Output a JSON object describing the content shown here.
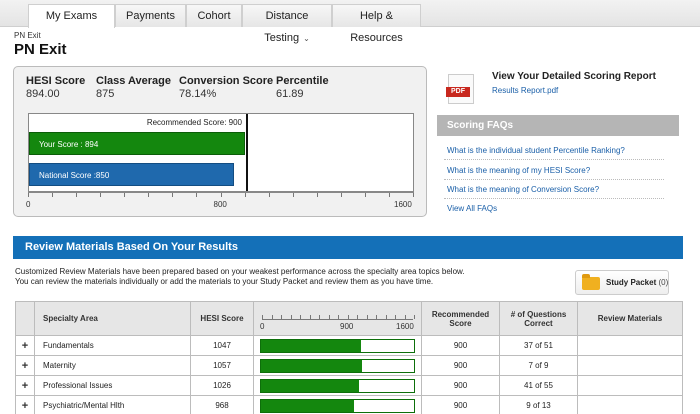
{
  "tabs": [
    {
      "label": "My Exams",
      "active": true
    },
    {
      "label": "Payments"
    },
    {
      "label": "Cohort"
    },
    {
      "label": "Distance Testing",
      "dropdown": true
    },
    {
      "label": "Help & Resources"
    }
  ],
  "breadcrumb": "PN Exit",
  "page_title": "PN Exit",
  "stats": {
    "hesi": {
      "label": "HESI Score",
      "value": "894.00"
    },
    "class_avg": {
      "label": "Class Average",
      "value": "875"
    },
    "conversion": {
      "label": "Conversion Score",
      "value": "78.14%"
    },
    "percentile": {
      "label": "Percentile",
      "value": "61.89"
    }
  },
  "chart_data": {
    "type": "bar",
    "orientation": "horizontal",
    "xlim": [
      0,
      1600
    ],
    "ticks": [
      "0",
      "800",
      "1600"
    ],
    "series": [
      {
        "label": "Your Score : 894",
        "value": 894,
        "color": "#14870e"
      },
      {
        "label": "National Score :850",
        "value": 850,
        "color": "#1f69ad"
      }
    ],
    "recommended": {
      "label": "Recommended Score: 900",
      "value": 900
    }
  },
  "report": {
    "title": "View Your Detailed Scoring Report",
    "link": "Results Report.pdf",
    "pdf_tag": "PDF"
  },
  "faq": {
    "header": "Scoring FAQs",
    "items": [
      "What is the individual student Percentile Ranking?",
      "What is the meaning of my HESI Score?",
      "What is the meaning of Conversion Score?",
      "View All FAQs"
    ]
  },
  "review": {
    "title": "Review Materials Based On Your Results",
    "intro_line1": "Customized Review Materials have been prepared based on your weakest performance across the specialty area topics below.",
    "intro_line2": "You can review the materials individually or add the materials to your Study Packet and review them as you have time.",
    "study_packet_label": "Study Packet",
    "study_packet_count": "(0)"
  },
  "table": {
    "headers": {
      "area": "Specialty Area",
      "hesi": "HESI Score",
      "recommended": "Recommended Score",
      "questions": "# of Questions Correct",
      "materials": "Review Materials"
    },
    "axis_ticks": [
      "0",
      "900",
      "1600"
    ],
    "axis_max": 1600,
    "rows": [
      {
        "area": "Fundamentals",
        "hesi": "1047",
        "score": 1047,
        "recommended": "900",
        "correct": "37 of 51"
      },
      {
        "area": "Maternity",
        "hesi": "1057",
        "score": 1057,
        "recommended": "900",
        "correct": "7 of 9"
      },
      {
        "area": "Professional Issues",
        "hesi": "1026",
        "score": 1026,
        "recommended": "900",
        "correct": "41 of 55"
      },
      {
        "area": "Psychiatric/Mental Hlth",
        "hesi": "968",
        "score": 968,
        "recommended": "900",
        "correct": "9 of 13"
      }
    ]
  }
}
